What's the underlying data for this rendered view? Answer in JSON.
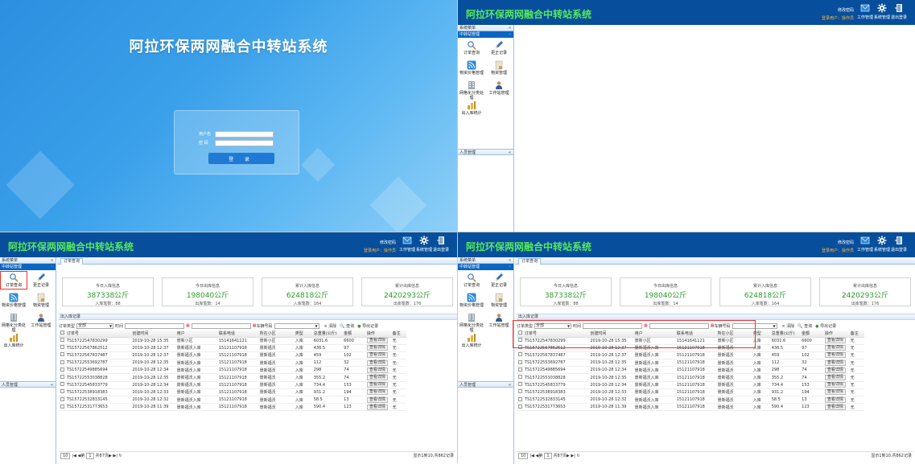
{
  "login": {
    "title": "阿拉环保两网融合中转站系统",
    "user_label": "用户名",
    "pwd_label": "密 码",
    "button": "登 录"
  },
  "app": {
    "title": "阿拉环保两网融合中转站系统",
    "change_pwd": "修改密码",
    "current_user": "登录用户：操作员",
    "tools": [
      "工作管理",
      "系统管理",
      "退出登录"
    ]
  },
  "sidebar": {
    "caption": "系统菜单",
    "section": "中转站管理",
    "items": [
      "订单查询",
      "更正记录",
      "物资价格管理",
      "物资管理",
      "网格化分类处理",
      "工作站管理",
      "出入库统计"
    ],
    "footer": "人员管理"
  },
  "tab": {
    "label": "订单查询"
  },
  "cards": [
    {
      "title": "今日入库信息",
      "value": "387338公斤",
      "sub": "入库笔数：88"
    },
    {
      "title": "今日出库信息",
      "value": "198040公斤",
      "sub": "出库笔数：14"
    },
    {
      "title": "累计入库信息",
      "value": "624818公斤",
      "sub": "入库笔数：164"
    },
    {
      "title": "累计出库信息",
      "value": "2420293公斤",
      "sub": "出库笔数：176"
    }
  ],
  "section_title": "出入库记录",
  "filter": {
    "type_label": "订单类型",
    "type_value": "全部",
    "time_label": "时间",
    "vehicle_label": "车辆号码",
    "clear": "× 清除",
    "query": "🔍 查询",
    "export": "导出记录"
  },
  "table": {
    "headers": [
      "订单号",
      "创建时间",
      "用户",
      "联系电话",
      "所在小区",
      "类型",
      "总重量(公斤)",
      "金额",
      "操作",
      "备注"
    ],
    "rows": [
      [
        "TS15722547830299",
        "2019-10-28 15:35",
        "景新小区",
        "15141641121",
        "景新小区",
        "入库",
        "6031.6",
        "6600",
        "查看详情",
        "无"
      ],
      [
        "TS15722567862512",
        "2019-10-28 12:37",
        "景新福沃入库",
        "15121107918",
        "景新福沃",
        "入库",
        "436.5",
        "97",
        "查看详情",
        "无"
      ],
      [
        "TS15722567837487",
        "2019-10-28 12:37",
        "景新福沃入库",
        "15121107918",
        "景新福沃",
        "入库",
        "459",
        "102",
        "查看详情",
        "无"
      ],
      [
        "TS15722553692787",
        "2019-10-28 12:35",
        "景新福沃入库",
        "15121107918",
        "景新福沃",
        "入库",
        "112",
        "32",
        "查看详情",
        "无"
      ],
      [
        "TS15722549885694",
        "2019-10-28 12:34",
        "景新福沃入库",
        "15121107918",
        "景新福沃",
        "入库",
        "298",
        "74",
        "查看详情",
        "无"
      ],
      [
        "TS15722553038828",
        "2019-10-28 12:35",
        "景新福沃入库",
        "15121107918",
        "景新福沃",
        "入库",
        "355.2",
        "74",
        "查看详情",
        "无"
      ],
      [
        "TS15722545833779",
        "2019-10-28 12:34",
        "景新福沃入库",
        "15121107918",
        "景新福沃",
        "入库",
        "734.4",
        "153",
        "查看详情",
        "无"
      ],
      [
        "TS15722538918383",
        "2019-10-28 12:33",
        "景新福沃入库",
        "15121107918",
        "景新福沃",
        "入库",
        "931.2",
        "194",
        "查看详情",
        "无"
      ],
      [
        "TS15722532833145",
        "2019-10-28 12:32",
        "景新福沃入库",
        "15121107918",
        "景新福沃",
        "入库",
        "58.5",
        "13",
        "查看详情",
        "无"
      ],
      [
        "TS15722531773653",
        "2019-10-28 11:39",
        "景新福沃入库",
        "15121107918",
        "景新福沃",
        "入库",
        "590.4",
        "123",
        "查看详情",
        "无"
      ]
    ]
  },
  "pager": {
    "size": "10",
    "page_label": "第",
    "page": "1",
    "total": "共87页",
    "info": "显示1到10,共862记录"
  }
}
